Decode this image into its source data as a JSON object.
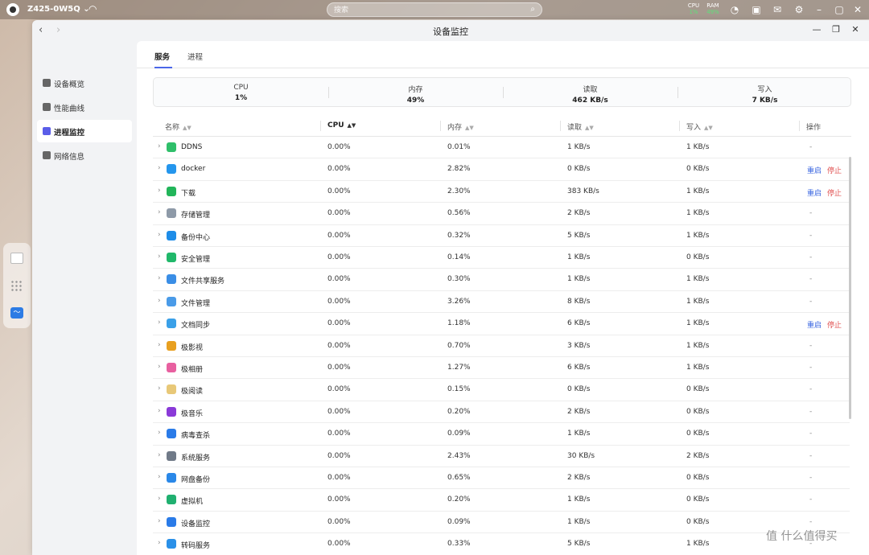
{
  "system": {
    "device_name": "Z425-0W5Q",
    "search_placeholder": "搜索",
    "cpu_label": "CPU",
    "cpu_value": "1%",
    "ram_label": "RAM",
    "ram_value": "49%"
  },
  "window": {
    "title": "设备监控",
    "back": "‹",
    "forward": "›",
    "minimize": "—",
    "restore": "❐",
    "close": "✕"
  },
  "sidebar": {
    "items": [
      {
        "label": "设备概览",
        "icon": "dashboard-icon"
      },
      {
        "label": "性能曲线",
        "icon": "chart-icon"
      },
      {
        "label": "进程监控",
        "icon": "process-icon",
        "active": true
      },
      {
        "label": "网络信息",
        "icon": "network-icon"
      }
    ]
  },
  "tabs": [
    {
      "label": "服务",
      "active": true
    },
    {
      "label": "进程"
    }
  ],
  "summary": [
    {
      "label": "CPU",
      "value": "1%"
    },
    {
      "label": "内存",
      "value": "49%"
    },
    {
      "label": "读取",
      "value": "462 KB/s"
    },
    {
      "label": "写入",
      "value": "7 KB/s"
    }
  ],
  "columns": {
    "name": "名称",
    "cpu": "CPU",
    "memory": "内存",
    "read": "读取",
    "write": "写入",
    "actions": "操作"
  },
  "actions": {
    "restart": "重启",
    "stop": "停止",
    "none": "-"
  },
  "rows": [
    {
      "name": "DDNS",
      "cpu": "0.00%",
      "mem": "0.01%",
      "read": "1 KB/s",
      "write": "1 KB/s",
      "ops": false,
      "color": "#2fbf6a"
    },
    {
      "name": "docker",
      "cpu": "0.00%",
      "mem": "2.82%",
      "read": "0 KB/s",
      "write": "0 KB/s",
      "ops": true,
      "color": "#2496ed"
    },
    {
      "name": "下载",
      "cpu": "0.00%",
      "mem": "2.30%",
      "read": "383 KB/s",
      "write": "1 KB/s",
      "ops": true,
      "color": "#22b55a"
    },
    {
      "name": "存储管理",
      "cpu": "0.00%",
      "mem": "0.56%",
      "read": "2 KB/s",
      "write": "1 KB/s",
      "ops": false,
      "color": "#8e9aa8"
    },
    {
      "name": "备份中心",
      "cpu": "0.00%",
      "mem": "0.32%",
      "read": "5 KB/s",
      "write": "1 KB/s",
      "ops": false,
      "color": "#1e8de8"
    },
    {
      "name": "安全管理",
      "cpu": "0.00%",
      "mem": "0.14%",
      "read": "1 KB/s",
      "write": "0 KB/s",
      "ops": false,
      "color": "#20b86a"
    },
    {
      "name": "文件共享服务",
      "cpu": "0.00%",
      "mem": "0.30%",
      "read": "1 KB/s",
      "write": "1 KB/s",
      "ops": false,
      "color": "#3a8ee6"
    },
    {
      "name": "文件管理",
      "cpu": "0.00%",
      "mem": "3.26%",
      "read": "8 KB/s",
      "write": "1 KB/s",
      "ops": false,
      "color": "#4a9be8"
    },
    {
      "name": "文档同步",
      "cpu": "0.00%",
      "mem": "1.18%",
      "read": "6 KB/s",
      "write": "1 KB/s",
      "ops": true,
      "color": "#3aa0e8"
    },
    {
      "name": "极影视",
      "cpu": "0.00%",
      "mem": "0.70%",
      "read": "3 KB/s",
      "write": "1 KB/s",
      "ops": false,
      "color": "#e8a020"
    },
    {
      "name": "极相册",
      "cpu": "0.00%",
      "mem": "1.27%",
      "read": "6 KB/s",
      "write": "1 KB/s",
      "ops": false,
      "color": "#e860a0"
    },
    {
      "name": "极阅读",
      "cpu": "0.00%",
      "mem": "0.15%",
      "read": "0 KB/s",
      "write": "0 KB/s",
      "ops": false,
      "color": "#e8c878"
    },
    {
      "name": "极音乐",
      "cpu": "0.00%",
      "mem": "0.20%",
      "read": "2 KB/s",
      "write": "0 KB/s",
      "ops": false,
      "color": "#8a3ad8"
    },
    {
      "name": "病毒查杀",
      "cpu": "0.00%",
      "mem": "0.09%",
      "read": "1 KB/s",
      "write": "0 KB/s",
      "ops": false,
      "color": "#2a7be8"
    },
    {
      "name": "系统服务",
      "cpu": "0.00%",
      "mem": "2.43%",
      "read": "30 KB/s",
      "write": "2 KB/s",
      "ops": false,
      "color": "#707a88"
    },
    {
      "name": "网盘备份",
      "cpu": "0.00%",
      "mem": "0.65%",
      "read": "2 KB/s",
      "write": "0 KB/s",
      "ops": false,
      "color": "#2a88e8"
    },
    {
      "name": "虚拟机",
      "cpu": "0.00%",
      "mem": "0.20%",
      "read": "1 KB/s",
      "write": "0 KB/s",
      "ops": false,
      "color": "#20b070"
    },
    {
      "name": "设备监控",
      "cpu": "0.00%",
      "mem": "0.09%",
      "read": "1 KB/s",
      "write": "0 KB/s",
      "ops": false,
      "color": "#2a7be8"
    },
    {
      "name": "转码服务",
      "cpu": "0.00%",
      "mem": "0.33%",
      "read": "5 KB/s",
      "write": "1 KB/s",
      "ops": false,
      "color": "#2a90e8"
    }
  ],
  "watermark": "值 什么值得买"
}
